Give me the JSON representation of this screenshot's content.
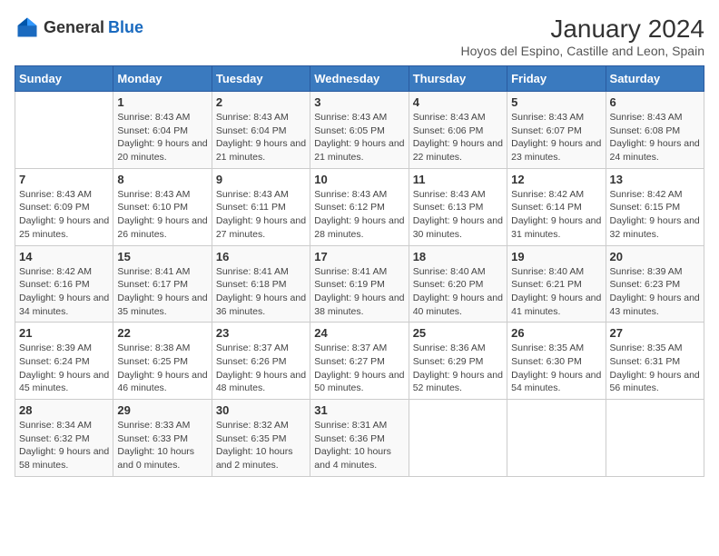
{
  "header": {
    "logo_general": "General",
    "logo_blue": "Blue",
    "month_year": "January 2024",
    "location": "Hoyos del Espino, Castille and Leon, Spain"
  },
  "weekdays": [
    "Sunday",
    "Monday",
    "Tuesday",
    "Wednesday",
    "Thursday",
    "Friday",
    "Saturday"
  ],
  "weeks": [
    [
      {
        "day": "",
        "sunrise": "",
        "sunset": "",
        "daylight": ""
      },
      {
        "day": "1",
        "sunrise": "Sunrise: 8:43 AM",
        "sunset": "Sunset: 6:04 PM",
        "daylight": "Daylight: 9 hours and 20 minutes."
      },
      {
        "day": "2",
        "sunrise": "Sunrise: 8:43 AM",
        "sunset": "Sunset: 6:04 PM",
        "daylight": "Daylight: 9 hours and 21 minutes."
      },
      {
        "day": "3",
        "sunrise": "Sunrise: 8:43 AM",
        "sunset": "Sunset: 6:05 PM",
        "daylight": "Daylight: 9 hours and 21 minutes."
      },
      {
        "day": "4",
        "sunrise": "Sunrise: 8:43 AM",
        "sunset": "Sunset: 6:06 PM",
        "daylight": "Daylight: 9 hours and 22 minutes."
      },
      {
        "day": "5",
        "sunrise": "Sunrise: 8:43 AM",
        "sunset": "Sunset: 6:07 PM",
        "daylight": "Daylight: 9 hours and 23 minutes."
      },
      {
        "day": "6",
        "sunrise": "Sunrise: 8:43 AM",
        "sunset": "Sunset: 6:08 PM",
        "daylight": "Daylight: 9 hours and 24 minutes."
      }
    ],
    [
      {
        "day": "7",
        "sunrise": "Sunrise: 8:43 AM",
        "sunset": "Sunset: 6:09 PM",
        "daylight": "Daylight: 9 hours and 25 minutes."
      },
      {
        "day": "8",
        "sunrise": "Sunrise: 8:43 AM",
        "sunset": "Sunset: 6:10 PM",
        "daylight": "Daylight: 9 hours and 26 minutes."
      },
      {
        "day": "9",
        "sunrise": "Sunrise: 8:43 AM",
        "sunset": "Sunset: 6:11 PM",
        "daylight": "Daylight: 9 hours and 27 minutes."
      },
      {
        "day": "10",
        "sunrise": "Sunrise: 8:43 AM",
        "sunset": "Sunset: 6:12 PM",
        "daylight": "Daylight: 9 hours and 28 minutes."
      },
      {
        "day": "11",
        "sunrise": "Sunrise: 8:43 AM",
        "sunset": "Sunset: 6:13 PM",
        "daylight": "Daylight: 9 hours and 30 minutes."
      },
      {
        "day": "12",
        "sunrise": "Sunrise: 8:42 AM",
        "sunset": "Sunset: 6:14 PM",
        "daylight": "Daylight: 9 hours and 31 minutes."
      },
      {
        "day": "13",
        "sunrise": "Sunrise: 8:42 AM",
        "sunset": "Sunset: 6:15 PM",
        "daylight": "Daylight: 9 hours and 32 minutes."
      }
    ],
    [
      {
        "day": "14",
        "sunrise": "Sunrise: 8:42 AM",
        "sunset": "Sunset: 6:16 PM",
        "daylight": "Daylight: 9 hours and 34 minutes."
      },
      {
        "day": "15",
        "sunrise": "Sunrise: 8:41 AM",
        "sunset": "Sunset: 6:17 PM",
        "daylight": "Daylight: 9 hours and 35 minutes."
      },
      {
        "day": "16",
        "sunrise": "Sunrise: 8:41 AM",
        "sunset": "Sunset: 6:18 PM",
        "daylight": "Daylight: 9 hours and 36 minutes."
      },
      {
        "day": "17",
        "sunrise": "Sunrise: 8:41 AM",
        "sunset": "Sunset: 6:19 PM",
        "daylight": "Daylight: 9 hours and 38 minutes."
      },
      {
        "day": "18",
        "sunrise": "Sunrise: 8:40 AM",
        "sunset": "Sunset: 6:20 PM",
        "daylight": "Daylight: 9 hours and 40 minutes."
      },
      {
        "day": "19",
        "sunrise": "Sunrise: 8:40 AM",
        "sunset": "Sunset: 6:21 PM",
        "daylight": "Daylight: 9 hours and 41 minutes."
      },
      {
        "day": "20",
        "sunrise": "Sunrise: 8:39 AM",
        "sunset": "Sunset: 6:23 PM",
        "daylight": "Daylight: 9 hours and 43 minutes."
      }
    ],
    [
      {
        "day": "21",
        "sunrise": "Sunrise: 8:39 AM",
        "sunset": "Sunset: 6:24 PM",
        "daylight": "Daylight: 9 hours and 45 minutes."
      },
      {
        "day": "22",
        "sunrise": "Sunrise: 8:38 AM",
        "sunset": "Sunset: 6:25 PM",
        "daylight": "Daylight: 9 hours and 46 minutes."
      },
      {
        "day": "23",
        "sunrise": "Sunrise: 8:37 AM",
        "sunset": "Sunset: 6:26 PM",
        "daylight": "Daylight: 9 hours and 48 minutes."
      },
      {
        "day": "24",
        "sunrise": "Sunrise: 8:37 AM",
        "sunset": "Sunset: 6:27 PM",
        "daylight": "Daylight: 9 hours and 50 minutes."
      },
      {
        "day": "25",
        "sunrise": "Sunrise: 8:36 AM",
        "sunset": "Sunset: 6:29 PM",
        "daylight": "Daylight: 9 hours and 52 minutes."
      },
      {
        "day": "26",
        "sunrise": "Sunrise: 8:35 AM",
        "sunset": "Sunset: 6:30 PM",
        "daylight": "Daylight: 9 hours and 54 minutes."
      },
      {
        "day": "27",
        "sunrise": "Sunrise: 8:35 AM",
        "sunset": "Sunset: 6:31 PM",
        "daylight": "Daylight: 9 hours and 56 minutes."
      }
    ],
    [
      {
        "day": "28",
        "sunrise": "Sunrise: 8:34 AM",
        "sunset": "Sunset: 6:32 PM",
        "daylight": "Daylight: 9 hours and 58 minutes."
      },
      {
        "day": "29",
        "sunrise": "Sunrise: 8:33 AM",
        "sunset": "Sunset: 6:33 PM",
        "daylight": "Daylight: 10 hours and 0 minutes."
      },
      {
        "day": "30",
        "sunrise": "Sunrise: 8:32 AM",
        "sunset": "Sunset: 6:35 PM",
        "daylight": "Daylight: 10 hours and 2 minutes."
      },
      {
        "day": "31",
        "sunrise": "Sunrise: 8:31 AM",
        "sunset": "Sunset: 6:36 PM",
        "daylight": "Daylight: 10 hours and 4 minutes."
      },
      {
        "day": "",
        "sunrise": "",
        "sunset": "",
        "daylight": ""
      },
      {
        "day": "",
        "sunrise": "",
        "sunset": "",
        "daylight": ""
      },
      {
        "day": "",
        "sunrise": "",
        "sunset": "",
        "daylight": ""
      }
    ]
  ]
}
